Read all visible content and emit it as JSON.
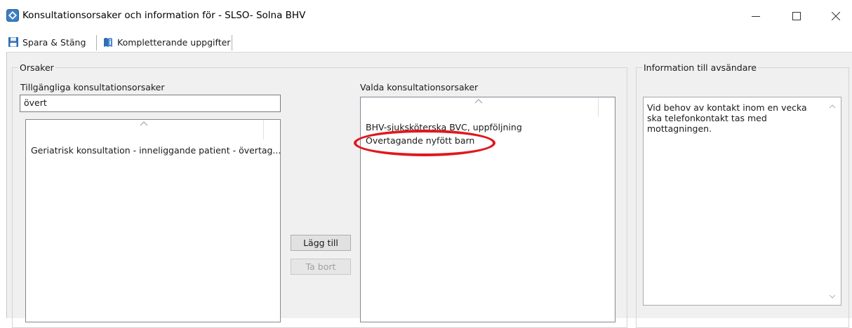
{
  "window": {
    "title": "Konsultationsorsaker och information för - SLSO- Solna BHV",
    "controls": {
      "minimize": "—",
      "maximize": "☐",
      "close": "✕"
    }
  },
  "toolbar": {
    "save_close_label": "Spara & Stäng",
    "supplementary_label": "Kompletterande uppgifter"
  },
  "reasons": {
    "group_title": "Orsaker",
    "available": {
      "label": "Tillgängliga konsultationsorsaker",
      "filter_value": "övert",
      "items": [
        "Geriatrisk konsultation - inneliggande patient - övertag..."
      ]
    },
    "selected": {
      "label": "Valda konsultationsorsaker",
      "items": [
        "BHV-sjuksköterska BVC, uppföljning",
        "Övertagande nyfött barn"
      ]
    },
    "add_button": "Lägg till",
    "remove_button": "Ta bort"
  },
  "sender_info": {
    "group_title": "Information till avsändare",
    "text": "Vid behov av kontakt inom en vecka ska telefonkontakt tas med mottagningen."
  },
  "colors": {
    "highlight": "#e0181f",
    "panel": "#f0f0f0"
  }
}
